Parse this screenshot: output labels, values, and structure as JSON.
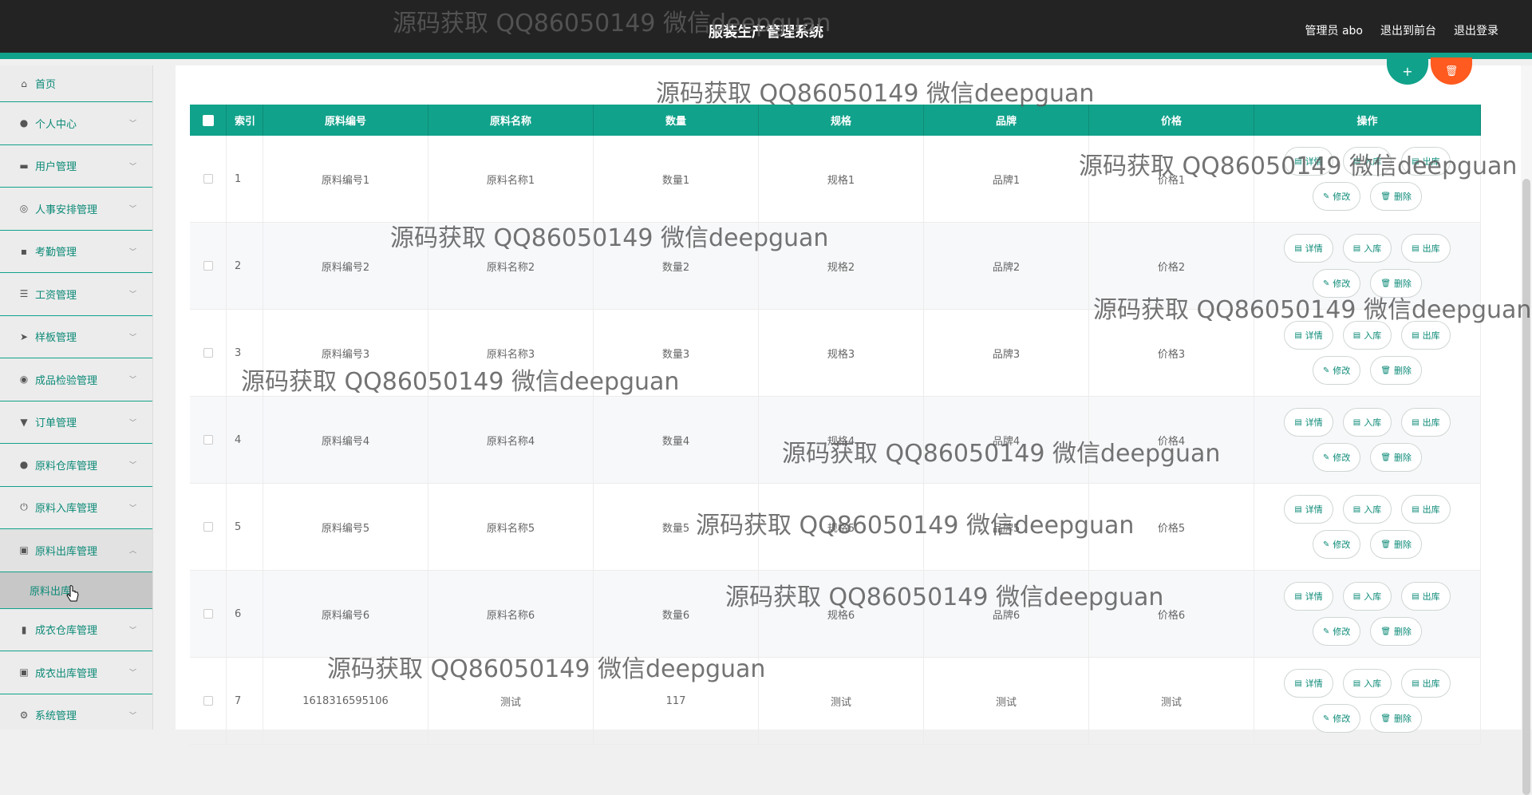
{
  "header": {
    "title": "服装生产管理系统",
    "links": [
      "管理员 abo",
      "退出到前台",
      "退出登录"
    ]
  },
  "sidebar": {
    "items": [
      {
        "label": "首页",
        "icon": "home-icon"
      },
      {
        "label": "个人中心",
        "icon": "user-icon"
      },
      {
        "label": "用户管理",
        "icon": "monitor-icon"
      },
      {
        "label": "人事安排管理",
        "icon": "compass-icon"
      },
      {
        "label": "考勤管理",
        "icon": "chat-icon"
      },
      {
        "label": "工资管理",
        "icon": "list-icon"
      },
      {
        "label": "样板管理",
        "icon": "send-icon"
      },
      {
        "label": "成品检验管理",
        "icon": "target-icon"
      },
      {
        "label": "订单管理",
        "icon": "cup-icon"
      },
      {
        "label": "原料仓库管理",
        "icon": "person-icon"
      },
      {
        "label": "原料入库管理",
        "icon": "power-icon"
      },
      {
        "label": "原料出库管理",
        "icon": "clipboard-icon"
      },
      {
        "label": "成衣仓库管理",
        "icon": "bar-chart-icon"
      },
      {
        "label": "成衣出库管理",
        "icon": "clipboard-icon"
      },
      {
        "label": "系统管理",
        "icon": "settings-icon"
      }
    ],
    "sub_item": "原料出库"
  },
  "table": {
    "headers": [
      "索引",
      "原料编号",
      "原料名称",
      "数量",
      "规格",
      "品牌",
      "价格",
      "操作"
    ],
    "rows": [
      [
        "1",
        "原料编号1",
        "原料名称1",
        "数量1",
        "规格1",
        "品牌1",
        "价格1"
      ],
      [
        "2",
        "原料编号2",
        "原料名称2",
        "数量2",
        "规格2",
        "品牌2",
        "价格2"
      ],
      [
        "3",
        "原料编号3",
        "原料名称3",
        "数量3",
        "规格3",
        "品牌3",
        "价格3"
      ],
      [
        "4",
        "原料编号4",
        "原料名称4",
        "数量4",
        "规格4",
        "品牌4",
        "价格4"
      ],
      [
        "5",
        "原料编号5",
        "原料名称5",
        "数量5",
        "规格5",
        "品牌5",
        "价格5"
      ],
      [
        "6",
        "原料编号6",
        "原料名称6",
        "数量6",
        "规格6",
        "品牌6",
        "价格6"
      ],
      [
        "7",
        "1618316595106",
        "测试",
        "117",
        "测试",
        "测试",
        "测试"
      ]
    ],
    "actions": [
      "详情",
      "入库",
      "出库",
      "修改",
      "删除"
    ]
  },
  "fab": {
    "add": "+",
    "delete": "🗑"
  },
  "watermark": "源码获取 QQ86050149 微信deepguan",
  "colors": {
    "accent": "#11a28b",
    "danger": "#ff5a1f",
    "topbar": "#232323"
  }
}
